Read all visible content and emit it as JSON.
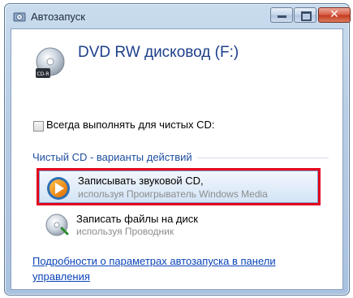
{
  "window": {
    "title": "Автозапуск",
    "app_icon": "autoplay-icon",
    "controls": {
      "minimize_icon": "minimize-icon",
      "maximize_icon": "maximize-icon",
      "close_icon": "close-icon",
      "close_glyph": "✕"
    }
  },
  "drive": {
    "title": "DVD RW дисковод (F:)",
    "icon": "dvd-rw-drive-icon",
    "icon_label": "CD-R"
  },
  "always_option": {
    "label": "Всегда выполнять для чистых CD:",
    "checked": false
  },
  "section": {
    "title": "Чистый CD - варианты действий"
  },
  "options": [
    {
      "title": "Записывать звуковой CD,",
      "subtitle": "используя Проигрыватель Windows Media",
      "icon": "windows-media-player-icon",
      "highlighted": true
    },
    {
      "title": "Записать файлы на диск",
      "subtitle": "используя Проводник",
      "icon": "burn-disc-icon",
      "highlighted": false
    }
  ],
  "footer": {
    "link_text": "Подробности о параметрах автозапуска в панели управления"
  },
  "colors": {
    "highlight_border": "#e3001b",
    "link": "#0b44b8",
    "heading": "#1d3f8b"
  }
}
